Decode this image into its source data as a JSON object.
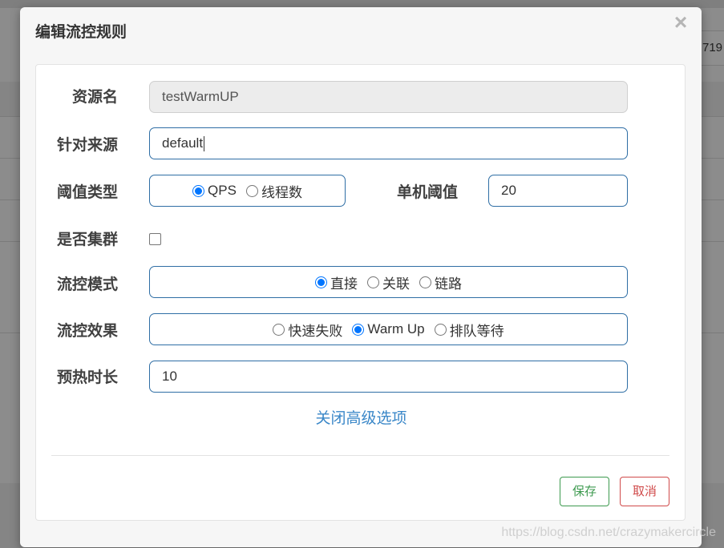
{
  "background": {
    "id_fragment": "719"
  },
  "modal": {
    "title": "编辑流控规则",
    "close_glyph": "×",
    "resource": {
      "label": "资源名",
      "value": "testWarmUP"
    },
    "limit_app": {
      "label": "针对来源",
      "value": "default"
    },
    "grade": {
      "label": "阈值类型",
      "options": [
        {
          "label": "QPS",
          "selected": true
        },
        {
          "label": "线程数",
          "selected": false
        }
      ]
    },
    "threshold": {
      "label": "单机阈值",
      "value": "20"
    },
    "cluster": {
      "label": "是否集群",
      "checked": false
    },
    "strategy": {
      "label": "流控模式",
      "options": [
        {
          "label": "直接",
          "selected": true
        },
        {
          "label": "关联",
          "selected": false
        },
        {
          "label": "链路",
          "selected": false
        }
      ]
    },
    "control_behavior": {
      "label": "流控效果",
      "options": [
        {
          "label": "快速失败",
          "selected": false
        },
        {
          "label": "Warm Up",
          "selected": true
        },
        {
          "label": "排队等待",
          "selected": false
        }
      ]
    },
    "warmup_period": {
      "label": "预热时长",
      "value": "10"
    },
    "advanced_link": "关闭高级选项",
    "buttons": {
      "save": "保存",
      "cancel": "取消"
    }
  },
  "watermark": "https://blog.csdn.net/crazymakercircle",
  "colors": {
    "accent": "#0075ff",
    "input_border": "#2f6ea5",
    "link": "#3a87c8",
    "save": "#3d9a4f",
    "cancel": "#d04a4a"
  }
}
